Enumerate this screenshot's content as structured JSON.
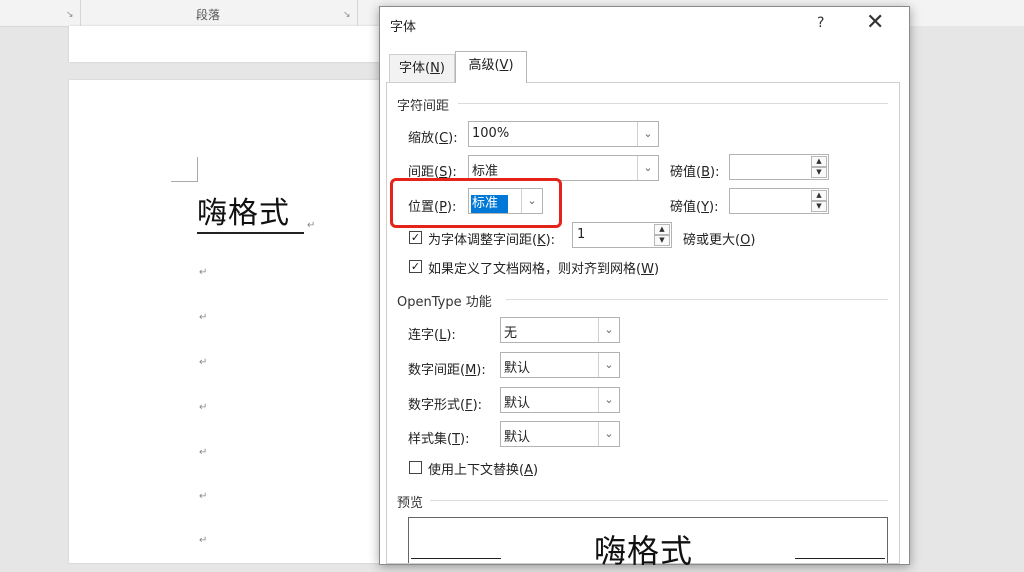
{
  "ribbon": {
    "group_label": "段落"
  },
  "document": {
    "heading": "嗨格式"
  },
  "dialog": {
    "title": "字体",
    "help_label": "?",
    "close_label": "✕",
    "tabs": [
      {
        "label": "字体(",
        "key": "N",
        "suffix": ")",
        "active": false
      },
      {
        "label": "高级(",
        "key": "V",
        "suffix": ")",
        "active": true
      }
    ],
    "char_spacing": {
      "section_title": "字符间距",
      "scale": {
        "label": "缩放(",
        "key": "C",
        "suffix": "):",
        "value": "100%"
      },
      "spacing": {
        "label": "间距(",
        "key": "S",
        "suffix": "):",
        "value": "标准"
      },
      "spacing_by": {
        "label": "磅值(",
        "key": "B",
        "suffix": "):",
        "value": ""
      },
      "position": {
        "label": "位置(",
        "key": "P",
        "suffix": "):",
        "value": "标准"
      },
      "position_by": {
        "label": "磅值(",
        "key": "Y",
        "suffix": "):",
        "value": ""
      },
      "kerning": {
        "checked": true,
        "label": "为字体调整字间距(",
        "key": "K",
        "suffix": "):",
        "value": "1",
        "after_label": "磅或更大(",
        "after_key": "O",
        "after_suffix": ")"
      },
      "snap_grid": {
        "checked": true,
        "label": "如果定义了文档网格，则对齐到网格(",
        "key": "W",
        "suffix": ")"
      }
    },
    "opentype": {
      "section_title": "OpenType 功能",
      "ligatures": {
        "label": "连字(",
        "key": "L",
        "suffix": "):",
        "value": "无"
      },
      "number_spacing": {
        "label": "数字间距(",
        "key": "M",
        "suffix": "):",
        "value": "默认"
      },
      "number_forms": {
        "label": "数字形式(",
        "key": "F",
        "suffix": "):",
        "value": "默认"
      },
      "stylistic_sets": {
        "label": "样式集(",
        "key": "T",
        "suffix": "):",
        "value": "默认"
      },
      "contextual_alternates": {
        "checked": false,
        "label": "使用上下文替换(",
        "key": "A",
        "suffix": ")"
      }
    },
    "preview": {
      "section_title": "预览",
      "text": "嗨格式"
    }
  },
  "colors": {
    "highlight": "#e4241b",
    "selection": "#0078d7"
  }
}
